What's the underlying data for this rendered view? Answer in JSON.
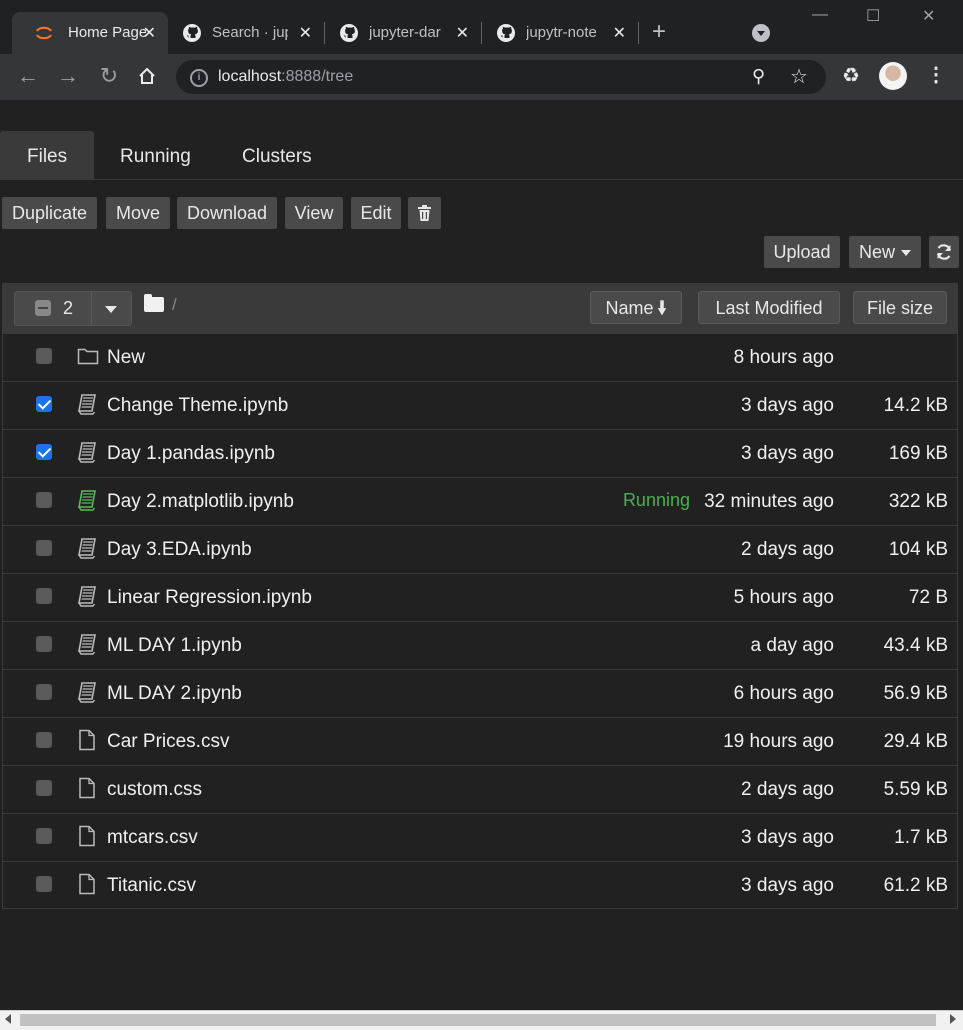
{
  "browser": {
    "tabs": [
      {
        "title": "Home Page",
        "icon": "jupyter-icon",
        "active": true
      },
      {
        "title": "Search · jup",
        "icon": "github-icon",
        "active": false
      },
      {
        "title": "jupyter-dar",
        "icon": "github-icon",
        "active": false
      },
      {
        "title": "jupytr-note",
        "icon": "github-icon",
        "active": false
      }
    ],
    "close_glyph": "✕",
    "new_tab_glyph": "+",
    "url_host": "localhost",
    "url_rest": ":8888/tree",
    "window_controls": [
      "—",
      "☐",
      "✕"
    ]
  },
  "page_tabs": {
    "files": "Files",
    "running": "Running",
    "clusters": "Clusters"
  },
  "actions": {
    "duplicate": "Duplicate",
    "move": "Move",
    "download": "Download",
    "view": "View",
    "edit": "Edit",
    "delete_icon": "trash-icon"
  },
  "right_actions": {
    "upload": "Upload",
    "new": "New",
    "refresh_icon": "refresh-icon"
  },
  "list_header": {
    "selected_count": "2",
    "breadcrumb": "/",
    "sort_name": "Name",
    "sort_modified": "Last Modified",
    "sort_size": "File size"
  },
  "files": [
    {
      "name": "New",
      "type": "folder",
      "checked": false,
      "status": "",
      "modified": "8 hours ago",
      "size": ""
    },
    {
      "name": "Change Theme.ipynb",
      "type": "notebook",
      "checked": true,
      "status": "",
      "modified": "3 days ago",
      "size": "14.2 kB"
    },
    {
      "name": "Day 1.pandas.ipynb",
      "type": "notebook",
      "checked": true,
      "status": "",
      "modified": "3 days ago",
      "size": "169 kB"
    },
    {
      "name": "Day 2.matplotlib.ipynb",
      "type": "notebook-running",
      "checked": false,
      "status": "Running",
      "modified": "32 minutes ago",
      "size": "322 kB"
    },
    {
      "name": "Day 3.EDA.ipynb",
      "type": "notebook",
      "checked": false,
      "status": "",
      "modified": "2 days ago",
      "size": "104 kB"
    },
    {
      "name": "Linear Regression.ipynb",
      "type": "notebook",
      "checked": false,
      "status": "",
      "modified": "5 hours ago",
      "size": "72 B"
    },
    {
      "name": "ML DAY 1.ipynb",
      "type": "notebook",
      "checked": false,
      "status": "",
      "modified": "a day ago",
      "size": "43.4 kB"
    },
    {
      "name": "ML DAY 2.ipynb",
      "type": "notebook",
      "checked": false,
      "status": "",
      "modified": "6 hours ago",
      "size": "56.9 kB"
    },
    {
      "name": "Car Prices.csv",
      "type": "file",
      "checked": false,
      "status": "",
      "modified": "19 hours ago",
      "size": "29.4 kB"
    },
    {
      "name": "custom.css",
      "type": "file",
      "checked": false,
      "status": "",
      "modified": "2 days ago",
      "size": "5.59 kB"
    },
    {
      "name": "mtcars.csv",
      "type": "file",
      "checked": false,
      "status": "",
      "modified": "3 days ago",
      "size": "1.7 kB"
    },
    {
      "name": "Titanic.csv",
      "type": "file",
      "checked": false,
      "status": "",
      "modified": "3 days ago",
      "size": "61.2 kB"
    }
  ],
  "colors": {
    "background": "#212121",
    "running": "#4caf50",
    "checkbox_checked": "#1a73e8",
    "button": "#4a4a4a"
  }
}
